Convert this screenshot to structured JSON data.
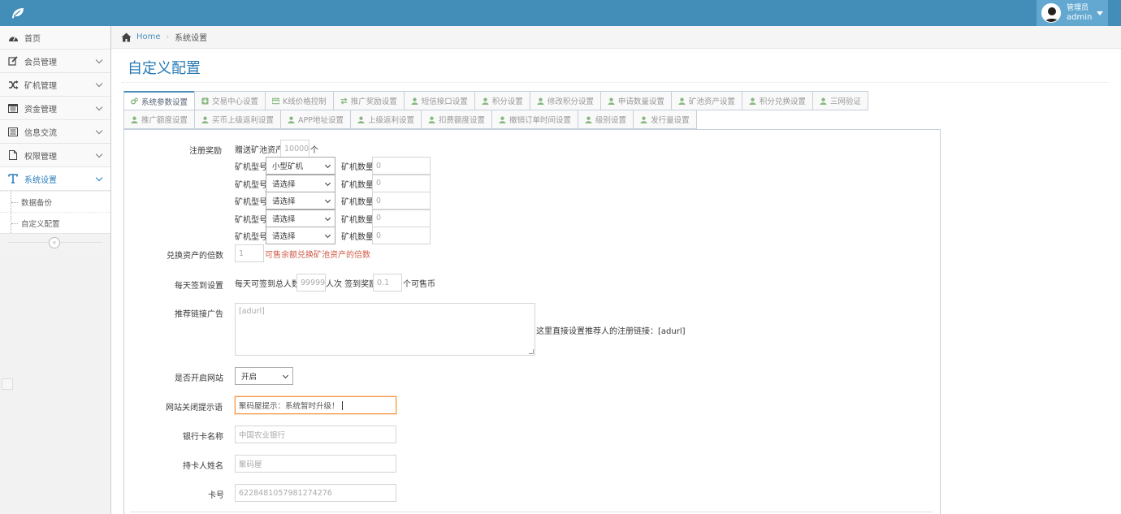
{
  "navbar": {
    "user_role": "管理员",
    "user_name": "admin",
    "colors": {
      "bar": "#438eb9",
      "user_box": "#62a8d1"
    }
  },
  "sidebar": {
    "items": [
      {
        "label": "首页",
        "icon": "tachometer-icon"
      },
      {
        "label": "会员管理",
        "icon": "edit-icon"
      },
      {
        "label": "矿机管理",
        "icon": "random-icon"
      },
      {
        "label": "资金管理",
        "icon": "calendar-icon"
      },
      {
        "label": "信息交流",
        "icon": "list-alt-icon"
      },
      {
        "label": "权限管理",
        "icon": "file-icon"
      },
      {
        "label": "系统设置",
        "icon": "text-icon"
      }
    ],
    "sub_items": [
      {
        "label": "数据备份"
      },
      {
        "label": "自定义配置"
      }
    ]
  },
  "breadcrumb": {
    "home": "Home",
    "current": "系统设置"
  },
  "page": {
    "title": "自定义配置"
  },
  "tabs_row1": [
    {
      "label": "系统参数设置",
      "icon": "cogs-icon"
    },
    {
      "label": "交易中心设置",
      "icon": "plus-square-icon"
    },
    {
      "label": "K线价格控制",
      "icon": "credit-card-icon"
    },
    {
      "label": "推广奖励设置",
      "icon": "exchange-icon"
    },
    {
      "label": "短信接口设置",
      "icon": "user-icon"
    },
    {
      "label": "积分设置",
      "icon": "user-icon"
    },
    {
      "label": "修改积分设置",
      "icon": "user-icon"
    },
    {
      "label": "申请数量设置",
      "icon": "user-icon"
    },
    {
      "label": "矿池资产设置",
      "icon": "user-icon"
    },
    {
      "label": "积分兑换设置",
      "icon": "user-icon"
    },
    {
      "label": "三网验证",
      "icon": "user-icon"
    }
  ],
  "tabs_row2": [
    {
      "label": "推广额度设置",
      "icon": "user-icon"
    },
    {
      "label": "买币上级返利设置",
      "icon": "user-icon"
    },
    {
      "label": "APP地址设置",
      "icon": "user-icon"
    },
    {
      "label": "上级返利设置",
      "icon": "user-icon"
    },
    {
      "label": "扣费额度设置",
      "icon": "user-icon"
    },
    {
      "label": "撤销订单时间设置",
      "icon": "user-icon"
    },
    {
      "label": "级别设置",
      "icon": "user-icon"
    },
    {
      "label": "发行量设置",
      "icon": "user-icon"
    }
  ],
  "form": {
    "register_reward": {
      "label": "注册奖励",
      "gift_label": "赠送矿池资产",
      "gift_value": "10000",
      "gift_unit": "个",
      "miner_type_label": "矿机型号",
      "miner_count_label": "矿机数量",
      "rows": [
        {
          "type": "小型矿机",
          "count": "0"
        },
        {
          "type": "请选择",
          "count": "0"
        },
        {
          "type": "请选择",
          "count": "0"
        },
        {
          "type": "请选择",
          "count": "0"
        },
        {
          "type": "请选择",
          "count": "0"
        }
      ]
    },
    "exchange_multiple": {
      "label": "兑换资产的倍数",
      "value": "1",
      "hint": "可售余额兑换矿池资产的倍数"
    },
    "daily_checkin": {
      "label": "每天签到设置",
      "prefix": "每天可签到总人数",
      "people_value": "99999",
      "middle": "人次 签到奖励",
      "reward_value": "0.1",
      "suffix": "个可售币"
    },
    "referral_ad": {
      "label": "推荐链接广告",
      "value": "[adurl]",
      "hint": "这里直接设置推荐人的注册链接：[adurl]"
    },
    "site_open": {
      "label": "是否开启网站",
      "value": "开启"
    },
    "close_tip": {
      "label": "网站关闭提示语",
      "value": "聚码屋提示：系统暂时升级！"
    },
    "bank_name": {
      "label": "银行卡名称",
      "value": "中国农业银行"
    },
    "card_holder": {
      "label": "持卡人姓名",
      "value": "聚码屋"
    },
    "card_number": {
      "label": "卡号",
      "value": "6228481057981274276"
    }
  }
}
